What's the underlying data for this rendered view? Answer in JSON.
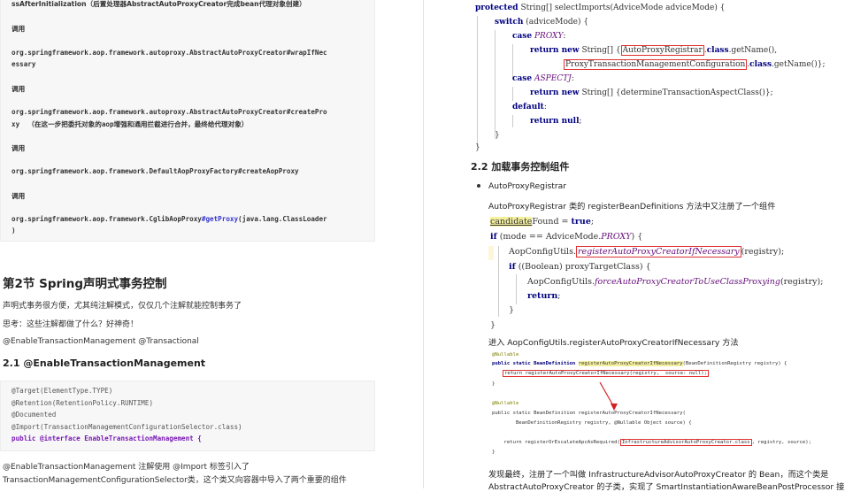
{
  "left": {
    "code_lines": [
      "ssAfterInitialization（后置处理器AbstractAutoProxyCreator完成bean代理对象创建）",
      "调用",
      "org.springframework.aop.framework.autoproxy.AbstractAutoProxyCreator#wrapIfNec",
      "essary",
      "调用",
      "org.springframework.aop.framework.autoproxy.AbstractAutoProxyCreator#createPro",
      "xy  （在这一步把委托对象的aop增强和通用拦截进行合并，最终给代理对象）",
      "调用",
      "org.springframework.aop.framework.DefaultAopProxyFactory#createAopProxy",
      "调用",
      "org.springframework.aop.framework.CglibAopProxy",
      "#getProxy",
      "(java.lang.ClassLoader",
      ")"
    ],
    "section_title": "第2节 Spring声明式事务控制",
    "para1": "声明式事务很方便，尤其纯注解模式，仅仅几个注解就能控制事务了",
    "para2": "思考：这些注解都做了什么？好神奇！",
    "para3": "@EnableTransactionManagement @Transactional",
    "sub_title": "2.1 @EnableTransactionManagement",
    "anno_lines": [
      "@Target(ElementType.TYPE)",
      "@Retention(RetentionPolicy.RUNTIME)",
      "@Documented",
      "@Import(TransactionManagementConfigurationSelector.class)",
      "public @interface EnableTransactionManagement {"
    ],
    "bottom1": "@EnableTransactionManagement 注解使用 @Import 标签引入了",
    "bottom2": "TransactionManagementConfigurationSelector类，这个类又向容器中导入了两个重要的组件"
  },
  "right": {
    "code": {
      "l1_kw": "protected",
      "l1_rest": " String[] selectImports(AdviceMode adviceMode) {",
      "l2_kw": "switch",
      "l2_rest": " (adviceMode) {",
      "l3_kw": "case",
      "l3_const": "PROXY",
      "l4_kw": "return new",
      "l4_mid": " String[] ",
      "l4_box": "AutoProxyRegistrar",
      "l4_tail_kw": "class",
      "l4_tail": ".getName(),",
      "l5_box": "ProxyTransactionManagementConfiguration",
      "l5_tail_kw": "class",
      "l5_tail": ".getName()};",
      "l6_const": "ASPECTJ",
      "l7_rest": " String[] {determineTransactionAspectClass()};",
      "l8_kw": "default",
      "l9_kw": "return null",
      "l10": "}",
      "l11": "}"
    },
    "sub_title": "2.2 加载事务控制组件",
    "bullet": "AutoProxyRegistrar",
    "desc": "AutoProxyRegistrar 类的 registerBeanDefinitions 方法中又注册了一个组件",
    "code2": {
      "l1_hl": "candidate",
      "l1_rest": "Found = ",
      "l1_kw": "true",
      "l2_kw": "if",
      "l2_rest": " (mode == AdviceMode.",
      "l2_const": "PROXY",
      "l2_end": ") {",
      "l3_pre": "AopConfigUtils.",
      "l3_box": "registerAutoProxyCreatorIfNecessary",
      "l3_end": "(registry);",
      "l4_kw": "if",
      "l4_rest": " ((Boolean) proxyTargetClass) {",
      "l5_pre": "AopConfigUtils.",
      "l5_it": "forceAutoProxyCreatorToUseClassProxying",
      "l5_end": "(registry);",
      "l6_kw": "return",
      "l7": "}",
      "l8": "}"
    },
    "desc2": "进入 AopConfigUtils.registerAutoProxyCreatorIfNecessary 方法",
    "small": {
      "a1": "@Nullable",
      "s1_pre": "public static BeanDefinition ",
      "s1_hl": "registerAutoProxyCreatorIfNecessary",
      "s1_rest": "(BeanDefinitionRegistry registry) {",
      "s2_box": "return registerAutoProxyCreatorIfNecessary(registry,  source: null);",
      "s3": "}",
      "a2": "@Nullable",
      "s4": "public static BeanDefinition registerAutoProxyCreatorIfNecessary(",
      "s5": "        BeanDefinitionRegistry registry, @Nullable Object source) {",
      "s6_pre": "    return registerOrEscalateApcAsRequired(",
      "s6_box": "InfrastructureAdvisorAutoProxyCreator.class",
      "s6_rest": ", registry, source);",
      "s7": "}"
    },
    "desc3": "发现最终，注册了一个叫做 InfrastructureAdvisorAutoProxyCreator 的 Bean，而这个类是",
    "desc4": "AbstractAutoProxyCreator 的子类，实现了 SmartInstantiationAwareBeanPostProcessor 接口"
  },
  "colors": {
    "keyword": "#000080",
    "constant": "#660e7a",
    "highlight_box": "#e03030",
    "link": "#3333cc"
  }
}
